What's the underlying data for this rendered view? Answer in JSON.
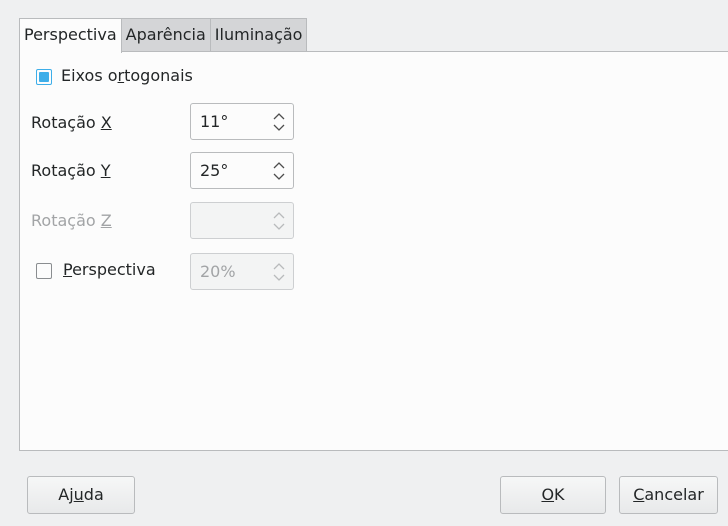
{
  "tabs": [
    {
      "label": "Perspectiva",
      "active": true
    },
    {
      "label": "Aparência",
      "active": false
    },
    {
      "label": "Iluminação",
      "active": false
    }
  ],
  "orthogonal_axes": {
    "checked": true,
    "label_pre": "Eixos o",
    "label_key": "r",
    "label_post": "togonais"
  },
  "rotation_x": {
    "label_pre": "Rotação ",
    "label_key": "X",
    "value": "11°",
    "enabled": true
  },
  "rotation_y": {
    "label_pre": "Rotação ",
    "label_key": "Y",
    "value": "25°",
    "enabled": true
  },
  "rotation_z": {
    "label_pre": "Rotação ",
    "label_key": "Z",
    "value": "",
    "enabled": false
  },
  "perspective": {
    "checked": false,
    "label_key": "P",
    "label_post": "erspectiva",
    "value": "20%",
    "enabled": false
  },
  "buttons": {
    "help": {
      "pre": "Aj",
      "key": "u",
      "post": "da"
    },
    "ok": {
      "pre": "",
      "key": "O",
      "post": "K"
    },
    "cancel": {
      "pre": "",
      "key": "C",
      "post": "ancelar"
    }
  },
  "colors": {
    "accent": "#3daee9",
    "window_bg": "#eff0f1",
    "disabled_text": "#a2a4a6"
  }
}
